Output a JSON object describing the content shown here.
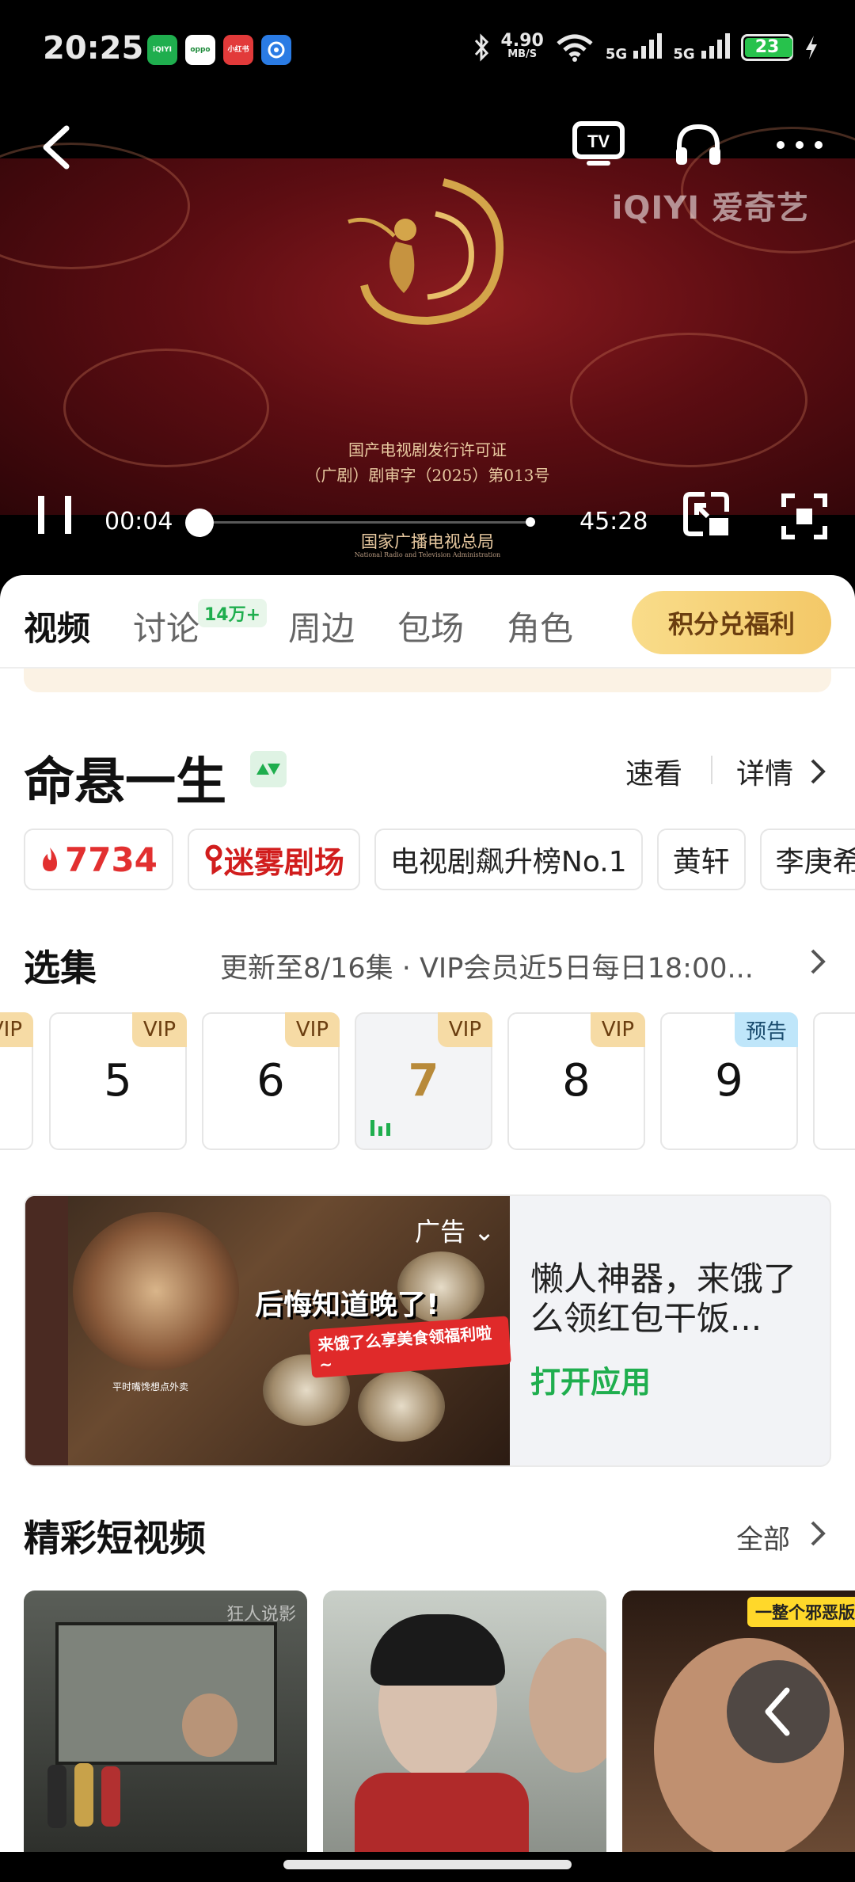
{
  "status_bar": {
    "time": "20:25",
    "apps": [
      {
        "name": "iqiyi-app",
        "label": "iQIYI\n爱奇艺",
        "color": "#1fae4e"
      },
      {
        "name": "oppo-app",
        "label": "oppo",
        "color": "#ffffff"
      },
      {
        "name": "xiaohongshu-app",
        "label": "小红书",
        "color": "#e23a3a"
      },
      {
        "name": "app-4",
        "label": "",
        "color": "#2a7be4"
      }
    ],
    "net_speed_value": "4.90",
    "net_speed_unit": "MB/S",
    "signal_1": "5G",
    "signal_2": "5G",
    "battery": "23",
    "battery_level": 0.23
  },
  "player": {
    "brand": "iQIYI 爱奇艺",
    "license_line1": "国产电视剧发行许可证",
    "license_line2": "（广剧）剧审字（2025）第013号",
    "issuer": "国家广播电视总局",
    "issuer_en": "National Radio and Television Administration",
    "current_time": "00:04",
    "duration": "45:28",
    "progress": 0.0015
  },
  "tabs": {
    "items": [
      {
        "label": "视频",
        "active": true
      },
      {
        "label": "讨论",
        "active": false
      },
      {
        "label": "周边",
        "active": false
      },
      {
        "label": "包场",
        "active": false
      },
      {
        "label": "角色",
        "active": false
      }
    ],
    "discussion_badge": "14万+",
    "points_button": "积分兑福利"
  },
  "show": {
    "title": "命悬一生",
    "quick_view": "速看",
    "details": "详情",
    "heat": "7734",
    "tags": [
      "迷雾剧场",
      "电视剧飙升榜No.1",
      "黄轩",
      "李庚希"
    ]
  },
  "episodes": {
    "heading": "选集",
    "update_info": "更新至8/16集 · VIP会员近5日每日18:00...",
    "partial_left_badge": "VIP",
    "items": [
      {
        "number": "5",
        "badge": "VIP",
        "badge_type": "vip",
        "current": false
      },
      {
        "number": "6",
        "badge": "VIP",
        "badge_type": "vip",
        "current": false
      },
      {
        "number": "7",
        "badge": "VIP",
        "badge_type": "vip",
        "current": true
      },
      {
        "number": "8",
        "badge": "VIP",
        "badge_type": "vip",
        "current": false
      },
      {
        "number": "9",
        "badge": "预告",
        "badge_type": "preview",
        "current": false
      }
    ]
  },
  "ad": {
    "label": "广告",
    "image_headline": "后悔知道晚了!",
    "image_sub": "来饿了么享美食领福利啦~",
    "image_small": "平时嘴馋想点外卖",
    "title": "懒人神器，来饿了么领红包干饭...",
    "cta": "打开应用"
  },
  "short_videos": {
    "heading": "精彩短视频",
    "all": "全部",
    "items": [
      {
        "watermark": "狂人说影",
        "tag": ""
      },
      {
        "watermark": "",
        "tag": ""
      },
      {
        "watermark": "",
        "tag": "一整个邪恶版黄毛"
      }
    ]
  },
  "colors": {
    "accent_green": "#1fae4e",
    "vip_gold": "#f6dba5",
    "points_gold": "#f3c867",
    "heat_red": "#e23030"
  }
}
